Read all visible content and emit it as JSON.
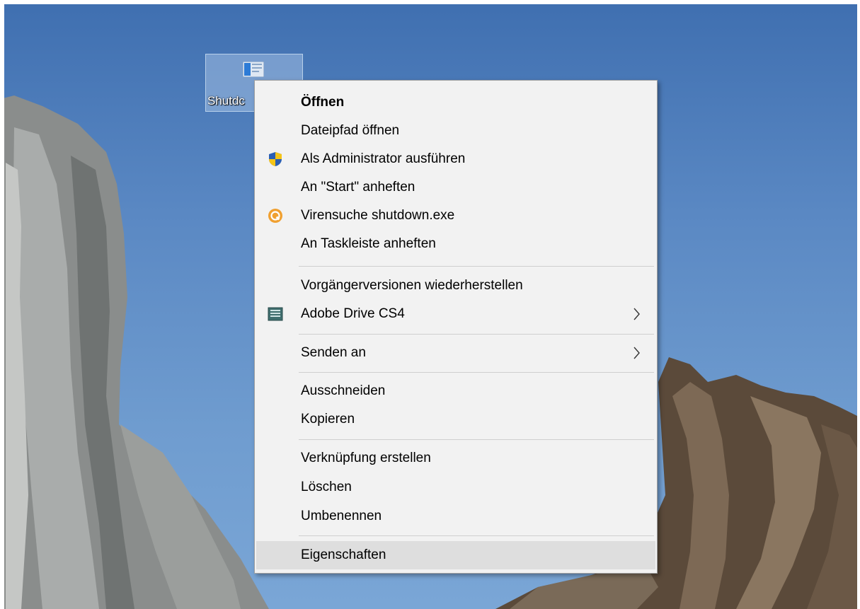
{
  "desktop": {
    "icon_label": "Shutdc"
  },
  "context_menu": {
    "items": [
      {
        "label": "Öffnen"
      },
      {
        "label": "Dateipfad öffnen"
      },
      {
        "label": "Als Administrator ausführen",
        "icon": "uac-shield-icon"
      },
      {
        "label": "An \"Start\" anheften"
      },
      {
        "label": "Virensuche shutdown.exe",
        "icon": "antivirus-icon"
      },
      {
        "label": "An Taskleiste anheften"
      },
      {
        "label": "Vorgängerversionen wiederherstellen"
      },
      {
        "label": "Adobe Drive CS4",
        "icon": "adobe-drive-icon",
        "submenu": true
      },
      {
        "label": "Senden an",
        "submenu": true
      },
      {
        "label": "Ausschneiden"
      },
      {
        "label": "Kopieren"
      },
      {
        "label": "Verknüpfung erstellen"
      },
      {
        "label": "Löschen"
      },
      {
        "label": "Umbenennen"
      },
      {
        "label": "Eigenschaften",
        "highlighted": true
      }
    ]
  },
  "colors": {
    "menu_background": "#f2f2f2",
    "menu_hover": "#dedede",
    "separator": "#cfcfcf",
    "shield_blue": "#2b5fb4",
    "shield_yellow": "#f5c518",
    "antivirus_orange": "#f0a030"
  }
}
